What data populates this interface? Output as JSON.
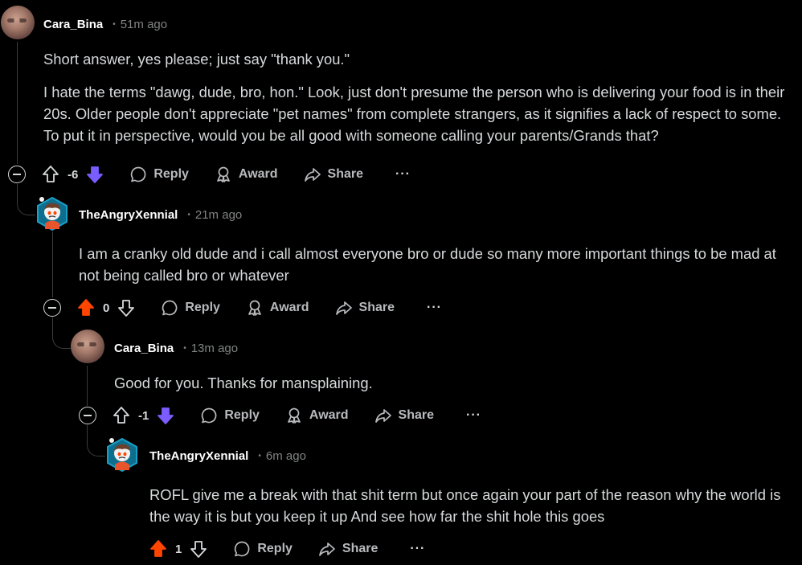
{
  "colors": {
    "background": "#000000",
    "text": "#d7dadc",
    "meta": "#818384",
    "upvote_active": "#ff4500",
    "downvote_active": "#7a5cff",
    "thread_line": "#3a3c3e"
  },
  "comments": [
    {
      "username": "Cara_Bina",
      "time": "51m ago",
      "paragraphs": [
        "Short answer, yes please; just say \"thank you.\"",
        "I hate the terms \"dawg, dude, bro, hon.\" Look, just don't presume the person who is delivering your food is in their 20s. Older people don't appreciate \"pet names\" from complete strangers, as it signifies a lack of respect to some. To put it in perspective, would you be all good with someone calling your parents/Grands that?"
      ],
      "score": "-6",
      "vote_state": "downvoted",
      "actions": {
        "reply": "Reply",
        "award": "Award",
        "share": "Share",
        "more": "···"
      }
    },
    {
      "username": "TheAngryXennial",
      "time": "21m ago",
      "paragraphs": [
        "I am a cranky old dude and i call almost everyone bro or dude so many more important things to be mad at not being called bro or whatever"
      ],
      "score": "0",
      "vote_state": "upvoted",
      "actions": {
        "reply": "Reply",
        "award": "Award",
        "share": "Share",
        "more": "···"
      }
    },
    {
      "username": "Cara_Bina",
      "time": "13m ago",
      "paragraphs": [
        "Good for you. Thanks for mansplaining."
      ],
      "score": "-1",
      "vote_state": "downvoted",
      "actions": {
        "reply": "Reply",
        "award": "Award",
        "share": "Share",
        "more": "···"
      }
    },
    {
      "username": "TheAngryXennial",
      "time": "6m ago",
      "paragraphs": [
        "ROFL give me a break with that shit term but once again your part of the reason why the world is the way it is but you keep it up And see how far the shit hole this goes"
      ],
      "score": "1",
      "vote_state": "upvoted",
      "actions": {
        "reply": "Reply",
        "share": "Share",
        "more": "···"
      }
    }
  ],
  "dot": "•"
}
